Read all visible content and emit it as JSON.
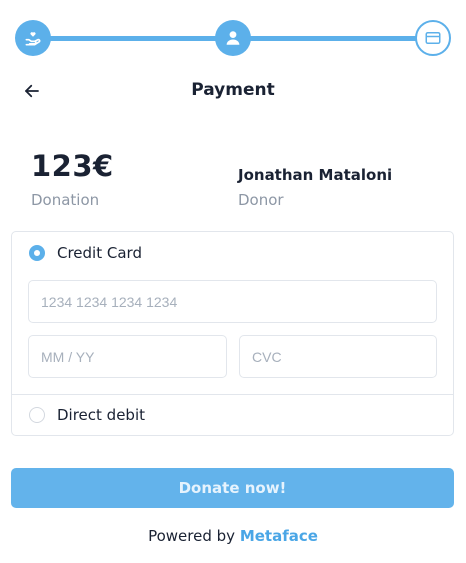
{
  "stepper": {
    "steps": [
      {
        "icon": "donate-hand-heart-icon",
        "state": "completed"
      },
      {
        "icon": "user-icon",
        "state": "completed"
      },
      {
        "icon": "credit-card-icon",
        "state": "current"
      }
    ],
    "accent_color": "#5cb0ea"
  },
  "header": {
    "back_icon": "arrow-left-icon",
    "title": "Payment"
  },
  "summary": {
    "amount": "123€",
    "amount_label": "Donation",
    "donor_name": "Jonathan Mataloni",
    "donor_label": "Donor"
  },
  "payment": {
    "options": [
      {
        "label": "Credit Card",
        "selected": true
      },
      {
        "label": "Direct debit",
        "selected": false
      }
    ],
    "card_number": {
      "value": "",
      "placeholder": "1234 1234 1234 1234"
    },
    "expiry": {
      "value": "",
      "placeholder": "MM / YY"
    },
    "cvc": {
      "value": "",
      "placeholder": "CVC"
    }
  },
  "donate_button": {
    "label": "Donate now!",
    "color": "#63b3eb"
  },
  "footer": {
    "powered_by": "Powered by",
    "brand": "Metaface",
    "brand_color": "#4aa6e6"
  }
}
